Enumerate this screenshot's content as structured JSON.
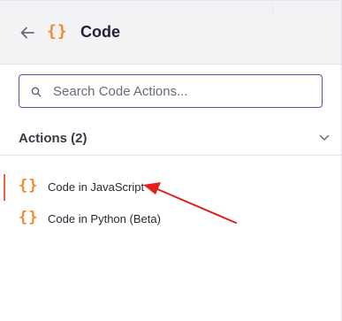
{
  "header": {
    "back_icon": "arrow-left-icon",
    "title_icon": "{}",
    "title": "Code"
  },
  "search": {
    "icon": "search-icon",
    "placeholder": "Search Code Actions..."
  },
  "actions": {
    "heading": "Actions (2)",
    "items": [
      {
        "icon": "{}",
        "label": "Code in JavaScript",
        "active": true
      },
      {
        "icon": "{}",
        "label": "Code in Python (Beta)",
        "active": false
      }
    ]
  },
  "colors": {
    "accent_orange": "#f08a2c",
    "active_indicator": "#f0603a",
    "search_border": "#5b4fb3",
    "annotation_arrow": "#e0201b"
  }
}
